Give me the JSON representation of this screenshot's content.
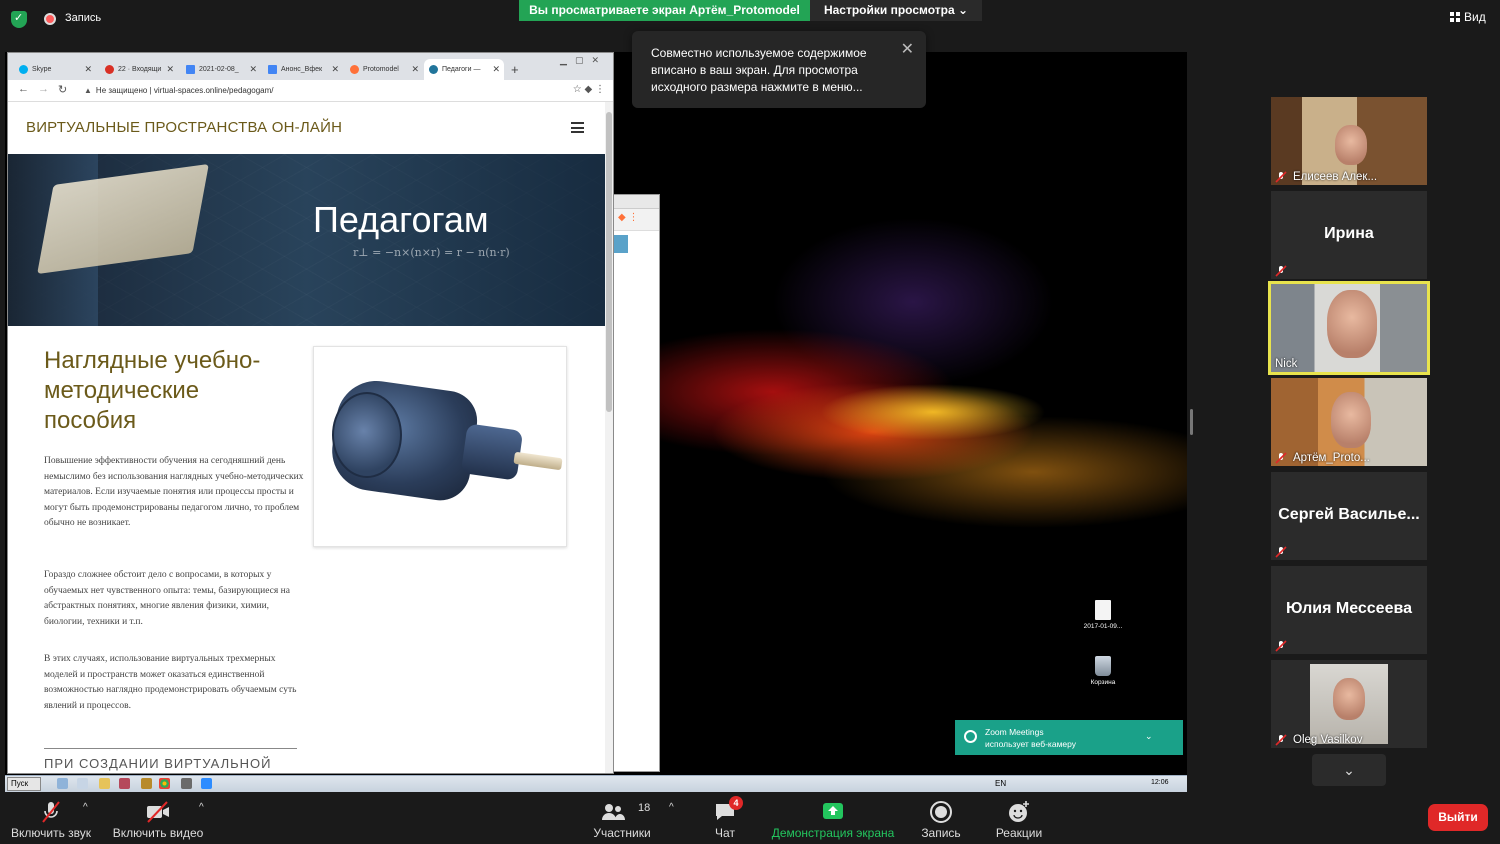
{
  "topbar": {
    "record_label": "Запись",
    "share_banner": "Вы просматриваете экран Артём_Protomodel",
    "view_settings": "Настройки просмотра ⌄",
    "view_button": "Вид"
  },
  "tooltip": {
    "text": "Совместно используемое содержимое вписано в ваш экран. Для просмотра исходного размера нажмите в меню...",
    "close_icon": "close-icon"
  },
  "browser": {
    "tabs": [
      {
        "label": "Skype",
        "color": "#00aff0"
      },
      {
        "label": "22 · Входящи",
        "color": "#d93025"
      },
      {
        "label": "2021-02-08_",
        "color": "#4285f4"
      },
      {
        "label": "Анонс_Вфек",
        "color": "#4285f4"
      },
      {
        "label": "Protomodel",
        "color": "#ff7139"
      },
      {
        "label": "Педагоги —",
        "color": "#21759b"
      }
    ],
    "security": "Не защищено",
    "url": "virtual-spaces.online/pedagogam/"
  },
  "page": {
    "site_title": "ВИРТУАЛЬНЫЕ ПРОСТРАНСТВА ОН-ЛАЙН",
    "hero_heading": "Педагогам",
    "hero_formula": "r⊥ = −n×(n×r) = r − n(n·r)",
    "heading": "Наглядные учебно-методические пособия",
    "p1": "Повышение эффективности обучения на сегодняшний день немыслимо без использования наглядных учебно-методических материалов. Если изучаемые понятия или процессы просты и могут быть продемонстрированы педагогом лично, то проблем обычно не возникает.",
    "p2": "Гораздо сложнее обстоит дело с вопросами, в которых у обучаемых нет чувственного опыта: темы, базирующиеся на абстрактных понятиях, многие явления физики, химии, биологии, техники и т.п.",
    "p3": "В этих случаях, использование виртуальных трехмерных моделей и пространств может оказаться единственной возможностью наглядно продемонстрировать обучаемым суть явлений и процессов.",
    "subhead": "ПРИ СОЗДАНИИ ВИРТУАЛЬНОЙ"
  },
  "desktop": {
    "icon1": "2017-01-09...",
    "icon2": "Корзина"
  },
  "taskbar": {
    "start": "Пуск",
    "lang": "EN",
    "clock": "12:06"
  },
  "toast": {
    "line1": "Zoom Meetings",
    "line2": "использует веб-камеру"
  },
  "participants": [
    {
      "name": "Елисеев Алек...",
      "muted": true
    },
    {
      "name": "Ирина",
      "muted": true
    },
    {
      "name": "Nick",
      "muted": false
    },
    {
      "name": "Артём_Proto...",
      "muted": true
    },
    {
      "name": "Сергей  Василье...",
      "muted": true
    },
    {
      "name": "Юлия Мессеева",
      "muted": true
    },
    {
      "name": "Oleg Vasilkov",
      "muted": true
    }
  ],
  "toolbar": {
    "unmute": "Включить звук",
    "start_video": "Включить видео",
    "participants": "Участники",
    "participants_count": "18",
    "chat": "Чат",
    "chat_badge": "4",
    "share": "Демонстрация экрана",
    "record": "Запись",
    "reactions": "Реакции",
    "leave": "Выйти"
  },
  "colors": {
    "zoom_green": "#23a455",
    "leave_red": "#e02828",
    "speaker_highlight": "#e8e34d",
    "site_brown": "#6b5a1a"
  }
}
